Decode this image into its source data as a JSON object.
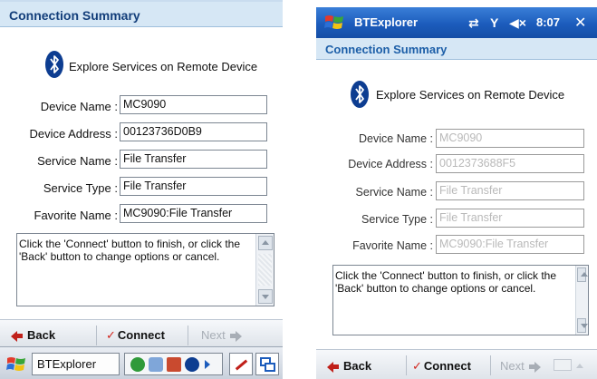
{
  "left": {
    "header": {
      "title": "Connection Summary"
    },
    "explore_text": "Explore Services on Remote Device",
    "fields": [
      {
        "label": "Device Name :",
        "value": "MC9090"
      },
      {
        "label": "Device Address :",
        "value": "00123736D0B9"
      },
      {
        "label": "Service Name :",
        "value": "File Transfer"
      },
      {
        "label": "Service Type :",
        "value": "File Transfer"
      },
      {
        "label": "Favorite Name :",
        "value": "MC9090:File Transfer"
      }
    ],
    "instructions": "Click the 'Connect' button to finish, or click the 'Back' button to change options or cancel.",
    "softkeys": {
      "back": "Back",
      "connect": "Connect",
      "next": "Next"
    },
    "taskbar": {
      "app_label": "BTExplorer"
    }
  },
  "right": {
    "topbar": {
      "app_title": "BTExplorer",
      "time": "8:07"
    },
    "header": {
      "title": "Connection Summary"
    },
    "explore_text": "Explore Services on Remote Device",
    "fields": [
      {
        "label": "Device Name :",
        "value": "MC9090"
      },
      {
        "label": "Device Address :",
        "value": "0012373688F5"
      },
      {
        "label": "Service Name :",
        "value": "File Transfer"
      },
      {
        "label": "Service Type :",
        "value": "File Transfer"
      },
      {
        "label": "Favorite Name :",
        "value": "MC9090:File Transfer"
      }
    ],
    "instructions": "Click the 'Connect' button to finish, or click the 'Back' button to change options or cancel.",
    "softkeys": {
      "back": "Back",
      "connect": "Connect",
      "next": "Next"
    }
  },
  "colors": {
    "header_bg": "#d6e7f5",
    "title_blue": "#133e7a",
    "taskbar_blue": "#1c5cbc",
    "back_arrow": "#c0201a"
  }
}
